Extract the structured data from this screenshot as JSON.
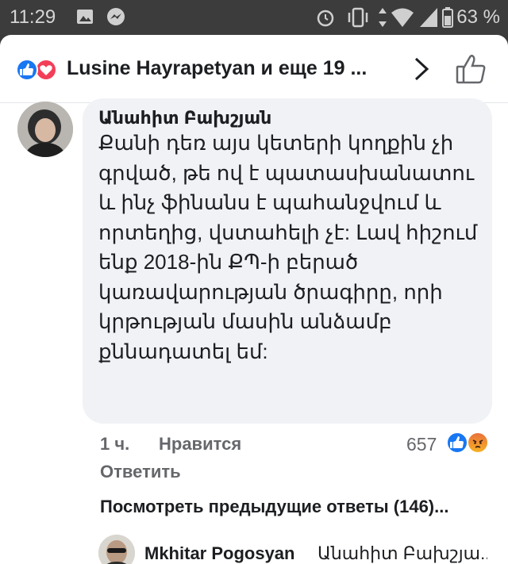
{
  "status_bar": {
    "time": "11:29",
    "battery_percent": "63 %",
    "icons": [
      "image-icon",
      "messenger-icon",
      "alarm-icon",
      "vibrate-icon",
      "data-arrows-icon",
      "wifi-icon",
      "signal-icon",
      "battery-icon"
    ]
  },
  "header": {
    "title": "Lusine Hayrapetyan и еще 19 ...",
    "reaction_icons": [
      "like-reaction-icon",
      "love-reaction-icon"
    ],
    "colors": {
      "like": "#1877f2",
      "love": "#f33e58"
    }
  },
  "comment": {
    "author": "Անահիտ Բախշյան",
    "text": "Քանի դեռ այս կետերի կողքին չի գրված, թե ով է պատասխանատու և ինչ ֆինանս է պահանջվում և որտեղից, վստահելի չէ: Լավ հիշում ենք 2018-ին ՔՊ-ի բերած կառավարության ծրագիրը, որի կրթության մասին անձամբ քննադատել եմ:",
    "time": "1 ч.",
    "like_label": "Нравится",
    "reply_label": "Ответить",
    "reaction_count": "657",
    "reaction_icons": [
      "like-reaction-icon",
      "angry-reaction-icon"
    ]
  },
  "previous_replies": {
    "label": "Посмотреть предыдущие ответы (146)..."
  },
  "reply": {
    "author": "Mkhitar Pogosyan",
    "text_preview": "Անահիտ Բախշյա..."
  }
}
